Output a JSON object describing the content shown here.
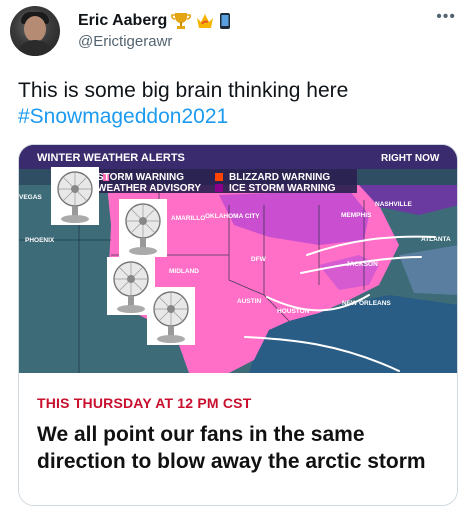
{
  "tweet": {
    "author_name": "Eric Aaberg",
    "badges": [
      "trophy-icon",
      "crown-icon",
      "phone-icon"
    ],
    "handle": "@Erictigerawr",
    "more_icon": "ellipsis-icon",
    "text": "This is some big brain thinking here",
    "hashtag": "#Snowmageddon2021"
  },
  "map": {
    "header": "WINTER WEATHER ALERTS",
    "time_label": "RIGHT NOW",
    "legend": [
      {
        "label": "STORM WARNING",
        "color": "#ff69b4"
      },
      {
        "label": "WEATHER ADVISORY",
        "color": "#7b68ee"
      },
      {
        "label": "BLIZZARD WARNING",
        "color": "#ff4500"
      },
      {
        "label": "ICE STORM WARNING",
        "color": "#8b008b"
      }
    ],
    "cities": [
      "NASHVILLE",
      "MEMPHIS",
      "OKLAHOMA CITY",
      "AMARILLO",
      "ATLANTA",
      "DFW",
      "JACKSON",
      "NEW ORLEANS",
      "AUSTIN",
      "HOUSTON",
      "MIDLAND",
      "PHOENIX",
      "VEGAS"
    ],
    "colors": {
      "snow": "#ff6ec7",
      "ice": "#c94fd0",
      "land": "#2f4e63",
      "header": "#3a2a6e"
    }
  },
  "caption": {
    "subtitle": "THIS THURSDAY AT 12 PM CST",
    "headline": "We all point our fans in the same direction to blow away the arctic storm"
  }
}
